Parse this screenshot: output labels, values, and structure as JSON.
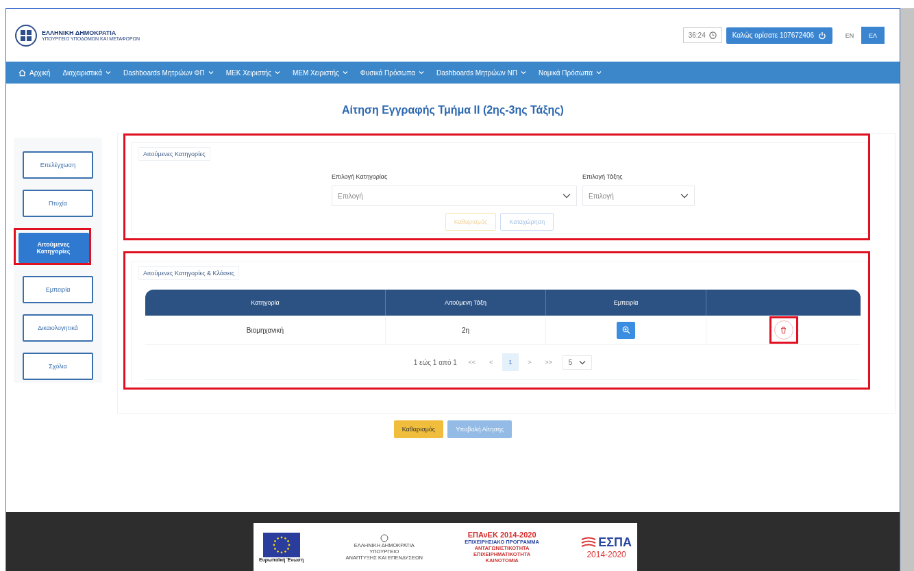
{
  "header": {
    "logo_title": "ΕΛΛΗΝΙΚΗ ΔΗΜΟΚΡΑΤΙΑ",
    "logo_subtitle": "ΥΠΟΥΡΓΕΙΟ ΥΠΟΔΟΜΩΝ ΚΑΙ ΜΕΤΑΦΟΡΩΝ",
    "timer": "36:24",
    "welcome": "Καλώς ορίσατε 107672406",
    "languages": [
      {
        "label": "EN",
        "selected": false
      },
      {
        "label": "ΕΛ",
        "selected": true
      }
    ]
  },
  "nav": [
    {
      "label": "Αρχική",
      "kind": "home",
      "dropdown": false
    },
    {
      "label": "Διαχειριστικά",
      "kind": "menu",
      "dropdown": true
    },
    {
      "label": "Dashboards Μητρώων ΦΠ",
      "kind": "menu",
      "dropdown": true
    },
    {
      "label": "ΜΕΚ Χειριστής",
      "kind": "menu",
      "dropdown": true
    },
    {
      "label": "ΜΕΜ Χειριστής",
      "kind": "menu",
      "dropdown": true
    },
    {
      "label": "Φυσικά Πρόσωπα",
      "kind": "menu",
      "dropdown": true
    },
    {
      "label": "Dashboards Μητρώων ΝΠ",
      "kind": "menu",
      "dropdown": true
    },
    {
      "label": "Νομικά Πρόσωπα",
      "kind": "menu",
      "dropdown": true
    }
  ],
  "page_title": "Αίτηση Εγγραφής Τμήμα ΙΙ (2ης-3ης Τάξης)",
  "sidebar": [
    {
      "label": "Επελέγχωση",
      "selected": false,
      "highlighted": false
    },
    {
      "label": "Πτυχία",
      "selected": false,
      "highlighted": false
    },
    {
      "label": "Αιτούμενες Κατηγορίες",
      "selected": true,
      "highlighted": true
    },
    {
      "label": "Εμπειρία",
      "selected": false,
      "highlighted": false
    },
    {
      "label": "Δικαιολογητικά",
      "selected": false,
      "highlighted": false
    },
    {
      "label": "Σχόλια",
      "selected": false,
      "highlighted": false
    }
  ],
  "form_section": {
    "legend": "Αιτούμενες Κατηγορίες",
    "highlighted": true,
    "fields": [
      {
        "label": "Επιλογή Κατηγορίας",
        "placeholder": "Επιλογή",
        "kind": "wide"
      },
      {
        "label": "Επιλογή Τάξης",
        "placeholder": "Επιλογή",
        "kind": "narrow"
      }
    ],
    "buttons": [
      {
        "label": "Καθαρισμός",
        "kind": "warning",
        "disabled": true
      },
      {
        "label": "Καταχώρηση",
        "kind": "primary",
        "disabled": true
      }
    ]
  },
  "table_section": {
    "legend": "Αιτούμενες Κατηγορίες & Κλάσεις",
    "highlighted": true,
    "columns": [
      "Κατηγορία",
      "Αιτούμενη Τάξη",
      "Εμπειρία"
    ],
    "rows": [
      {
        "category": "Βιομηχανική",
        "grade": "2η",
        "delete_highlighted": true
      }
    ],
    "pagination": {
      "summary": "1 εώς 1 από 1",
      "first": "<<",
      "prev": "<",
      "pages": [
        {
          "label": "1",
          "selected": true
        }
      ],
      "next": ">",
      "last": ">>",
      "page_size": "5"
    }
  },
  "actions": [
    {
      "label": "Καθαρισμός",
      "kind": "warning",
      "disabled": false
    },
    {
      "label": "Υποβολή Αίτησης",
      "kind": "primary",
      "disabled": true
    }
  ],
  "footer": {
    "eu": "Ευρωπαϊκή Ένωση",
    "ministry": [
      "ΕΛΛΗΝΙΚΗ ΔΗΜΟΚΡΑΤΙΑ",
      "ΥΠΟΥΡΓΕΙΟ",
      "ΑΝΑΠΤΥΞΗΣ ΚΑΙ ΕΠΕΝΔΥΣΕΩΝ"
    ],
    "epanek_title": "ΕΠΑνΕΚ 2014-2020",
    "epanek_lines": [
      "ΕΠΙΧΕΙΡΗΣΙΑΚΟ ΠΡΟΓΡΑΜΜΑ",
      "ΑΝΤΑΓΩΝΙΣΤΙΚΟΤΗΤΑ",
      "ΕΠΙΧΕΙΡΗΜΑΤΙΚΟΤΗΤΑ",
      "ΚΑΙΝΟΤΟΜΙΑ"
    ],
    "espa": "ΕΣΠΑ",
    "espa_years": "2014-2020"
  }
}
